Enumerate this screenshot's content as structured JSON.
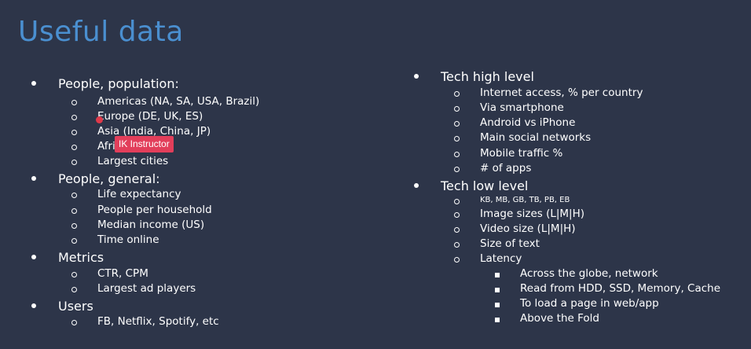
{
  "title": "Useful data",
  "left": [
    {
      "label": "People, population:",
      "items": [
        "Americas (NA, SA, USA, Brazil)",
        "Europe (DE, UK, ES)",
        "Asia (India, China, JP)",
        "Afri",
        "Largest cities"
      ]
    },
    {
      "label": "People, general:",
      "items": [
        "Life expectancy",
        "People per household",
        "Median income (US)",
        "Time online"
      ]
    },
    {
      "label": "Metrics",
      "items": [
        "CTR, CPM",
        "Largest ad players"
      ]
    },
    {
      "label": "Users",
      "items": [
        "FB, Netflix, Spotify, etc"
      ]
    }
  ],
  "right": [
    {
      "label": "Tech high level",
      "items": [
        "Internet access, % per country",
        "Via smartphone",
        "Android vs iPhone",
        "Main social networks",
        "Mobile traffic %",
        "# of apps"
      ]
    },
    {
      "label": "Tech low level",
      "items": [
        "KB, MB, GB, TB, PB, EB",
        "Image sizes (L|M|H)",
        "Video size (L|M|H)",
        "Size of text",
        "Latency"
      ],
      "latency_items": [
        "Across the globe, network",
        "Read from HDD, SSD, Memory, Cache",
        "To load a page in web/app",
        "Above the Fold"
      ]
    }
  ],
  "overlay": {
    "badge_label": "IK Instructor"
  }
}
